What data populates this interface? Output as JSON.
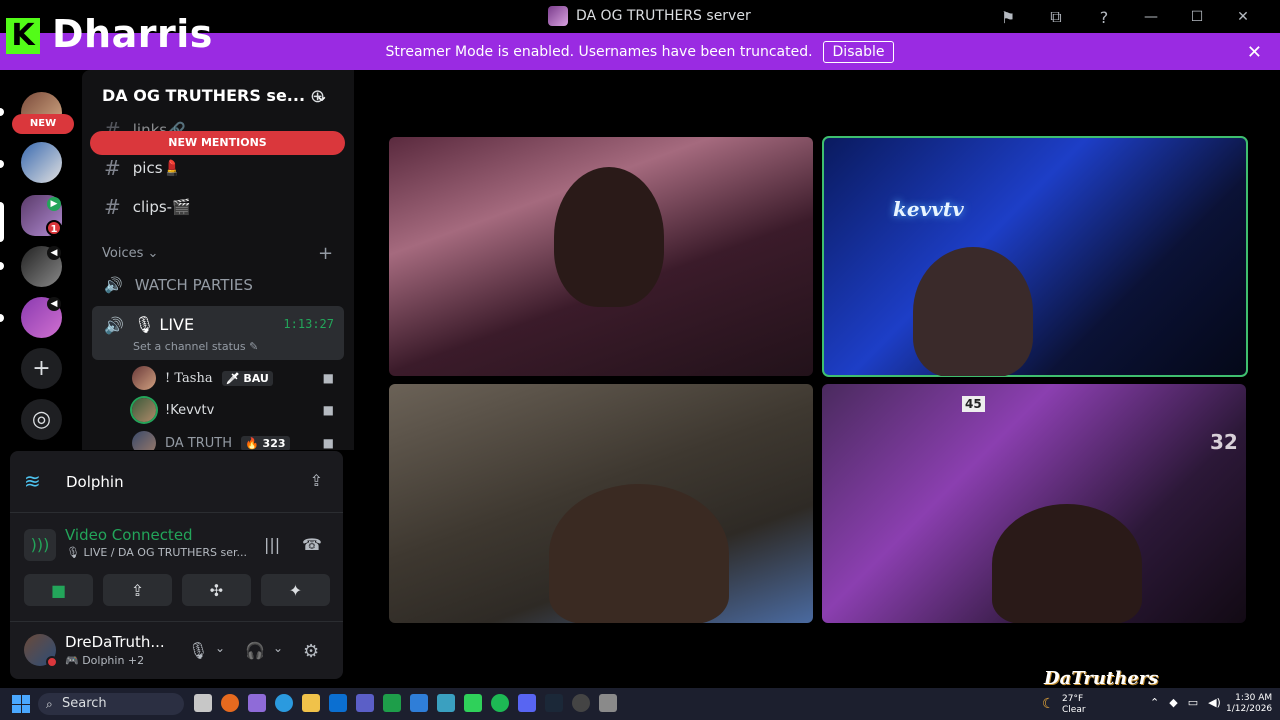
{
  "brand": {
    "letter": "K",
    "name": "Dharris"
  },
  "window": {
    "title": "DA OG TRUTHERS server",
    "minimize": "—",
    "maximize": "☐",
    "close": "✕"
  },
  "banner": {
    "text": "Streamer Mode is enabled. Usernames have been truncated.",
    "button": "Disable",
    "close": "✕"
  },
  "rail": {
    "new_label": "NEW",
    "badge_count": "1"
  },
  "server": {
    "name": "DA OG TRUTHERS se...",
    "chevron": "⌄"
  },
  "channels": {
    "mentions_label": "NEW MENTIONS",
    "items": [
      {
        "hash": "#",
        "name": "links🔗"
      },
      {
        "hash": "#",
        "name": "pics💄"
      },
      {
        "hash": "#",
        "name": "clips-🎬"
      }
    ],
    "voices_category": "Voices ⌄",
    "add": "+",
    "watch_parties": "WATCH PARTIES",
    "live": {
      "name": "🎙 LIVE",
      "timer": "1:13:27",
      "status": "Set a channel status ✎"
    },
    "members": [
      {
        "name": "! Tasha",
        "tag": "🗡 BAU"
      },
      {
        "name": "!Kevvtv",
        "tag": ""
      },
      {
        "name": "DA TRUTH",
        "tag": "🔥 323"
      }
    ]
  },
  "voice_panel": {
    "activity": "Dolphin",
    "connection_title": "Video Connected",
    "connection_sub": "🎙 LIVE / DA OG TRUTHERS ser...",
    "user_name": "DreDaTruth...",
    "user_sub": "🎮 Dolphin +2"
  },
  "tiles": {
    "neon_text": "kevvtv",
    "jersey_number": "32",
    "sign_number": "45"
  },
  "watermark": "DaTruthers",
  "taskbar": {
    "search": "Search",
    "weather_temp": "27°F",
    "weather_desc": "Clear",
    "time": "1:30 AM",
    "date": "1/12/2026"
  },
  "colors": {
    "accent_purple": "#9a2be2",
    "mention_red": "#da373c",
    "connected_green": "#23a55a",
    "speaking_outline": "#3fbf6f",
    "kick_green": "#53fc18"
  }
}
